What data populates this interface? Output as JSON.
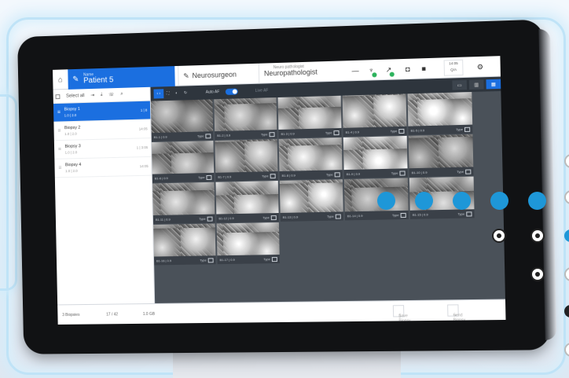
{
  "header": {
    "patient_small": "Name",
    "patient_name": "Patient 5",
    "surgeon_label": "Neurosurgeon",
    "pathologist_small": "Neuro pathologist",
    "pathologist_label": "Neuropathologist",
    "time_top": "14:05",
    "time_bottom": "Q/A"
  },
  "sidebar": {
    "select_all": "Select all",
    "items": [
      {
        "title": "Biopsy 1",
        "sub": "1.0 | 2.0",
        "right": "1 | 8",
        "active": true
      },
      {
        "title": "Biopsy 2",
        "sub": "1.0 | 2.0",
        "right": "14:05",
        "active": false
      },
      {
        "title": "Biopsy 3",
        "sub": "1.0 | 2.0",
        "right": "1 | 3:05",
        "active": false
      },
      {
        "title": "Biopsy 4",
        "sub": "1.0 | 2.0",
        "right": "14:05",
        "active": false
      }
    ]
  },
  "toolbar": {
    "auto_label": "Auto AF",
    "filter_label": "Live AF"
  },
  "thumbnails": [
    {
      "caption": "B1-1 | 0.9",
      "tag": "Type"
    },
    {
      "caption": "B1-2 | 0.9",
      "tag": "Type"
    },
    {
      "caption": "B1-3 | 0.9",
      "tag": "Type"
    },
    {
      "caption": "B1-4 | 0.9",
      "tag": "Type"
    },
    {
      "caption": "B1-5 | 0.9",
      "tag": "Type"
    },
    {
      "caption": "B1-6 | 0.9",
      "tag": "Type"
    },
    {
      "caption": "B1-7 | 0.9",
      "tag": "Type"
    },
    {
      "caption": "B1-8 | 0.9",
      "tag": "Type"
    },
    {
      "caption": "B1-9 | 0.9",
      "tag": "Type"
    },
    {
      "caption": "B1-10 | 0.9",
      "tag": "Type"
    },
    {
      "caption": "B1-11 | 0.9",
      "tag": "Type"
    },
    {
      "caption": "B1-12 | 0.9",
      "tag": "Type"
    },
    {
      "caption": "B1-13 | 0.9",
      "tag": "Type"
    },
    {
      "caption": "B1-14 | 0.9",
      "tag": "Type"
    },
    {
      "caption": "B1-15 | 0.9",
      "tag": "Type"
    },
    {
      "caption": "B1-16 | 0.9",
      "tag": "Type"
    },
    {
      "caption": "B1-17 | 0.9",
      "tag": "Type"
    }
  ],
  "footer": {
    "f1": "3 Biopsies",
    "f2": "17 / 42",
    "f3": "1.0 GB",
    "btn1": "Save Biopsy",
    "btn2": "Send Biopsy"
  },
  "colors": {
    "accent": "#1b6fe0",
    "decor_dot": "#1e97d8",
    "status_green": "#2db35d"
  }
}
